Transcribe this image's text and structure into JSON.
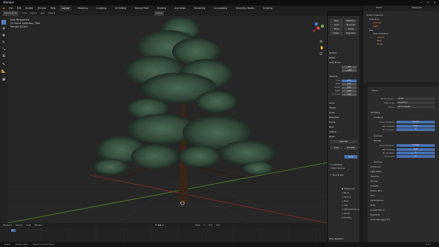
{
  "window": {
    "title": "Blender",
    "controls": [
      "—",
      "☐",
      "✕"
    ]
  },
  "menu": [
    "File",
    "Edit",
    "Render",
    "Window",
    "Help"
  ],
  "workspace_tabs": [
    "Layout",
    "Modeling",
    "Sculpting",
    "UV Editing",
    "Texture Paint",
    "Shading",
    "Animation",
    "Rendering",
    "Compositing",
    "Geometry Nodes",
    "Scripting"
  ],
  "active_tab": "Layout",
  "topright": {
    "scene": "Scene",
    "view_layer": "ViewLayer"
  },
  "viewport_header": {
    "mode": "Object Mode",
    "items": [
      "View",
      "Select",
      "Add",
      "Object"
    ],
    "orientation": "Global"
  },
  "viewport_overlay": {
    "line1": "User Perspective",
    "line2": "(1) Scene Collection | Tree",
    "line3": "Sample 3/1024"
  },
  "npanel": {
    "top_buttons": [
      "Bark",
      "Resolution",
      "Trunk",
      "Branches",
      "Twigs",
      "Leaves",
      "Stems",
      "Twig Apply"
    ],
    "sections": [
      "Record",
      "Reset",
      "Auto Prune",
      "General",
      "Grow",
      "Shape",
      "Trunk",
      "Branches",
      "Prune",
      "Bark",
      "Leaves",
      "Build"
    ],
    "fields": [
      {
        "label": "Seed",
        "value": "101"
      },
      {
        "label": "Branch Fork",
        "value": "1.000"
      },
      {
        "label": "Scale",
        "value": "0.00"
      },
      {
        "label": "Width",
        "value": "0.00"
      },
      {
        "label": "Length",
        "value": "0.00"
      },
      {
        "label": "Height",
        "value": "0.00"
      },
      {
        "label": "Thickness",
        "value": "0.00"
      }
    ],
    "bottom_buttons": [
      "Generate",
      "Build",
      "Simulate",
      "Apply"
    ],
    "checkbox_labels": [
      "Leaf Mesh",
      "Bark Texture",
      "Twig Shape"
    ],
    "presets": [
      "Preference",
      "Birch",
      "Spruce",
      "Pine",
      "Oak",
      "Hardwood Boule",
      "Shrub",
      "Fantasy"
    ],
    "bottom_label": "Tree Variation"
  },
  "outliner": {
    "rows": [
      "Scene Collection",
      "Collection",
      "Camera",
      "Light",
      "Tree",
      "Tree Collection",
      "Leaves",
      "Bark",
      "Twigs"
    ]
  },
  "properties": {
    "object_label": "Scene",
    "render_engine_label": "Render Engine",
    "render_engine": "Cycles",
    "feature_set_label": "Feature Set",
    "feature_set": "Supported",
    "device_label": "Device",
    "device": "GPU Compute",
    "sections": [
      "Sampling",
      "Viewport",
      "Render",
      "Denoise",
      "Advanced",
      "Light Paths",
      "Volumes",
      "Curves",
      "Simplify",
      "Motion Blur",
      "Film",
      "Performance",
      "Bake",
      "Grease Pencil",
      "Freestyle",
      "Color Management"
    ],
    "viewport_fields": [
      {
        "label": "Noise Threshold",
        "value": "0.1000"
      },
      {
        "label": "Max Samples",
        "value": "1024"
      },
      {
        "label": "Min Samples",
        "value": "0"
      }
    ],
    "render_fields": [
      {
        "label": "Noise Threshold",
        "value": "0.0100"
      },
      {
        "label": "Max Samples",
        "value": "4096"
      },
      {
        "label": "Min Samples",
        "value": "0"
      },
      {
        "label": "Time Limit",
        "value": "0 s"
      }
    ]
  },
  "timeline": {
    "items": [
      "Playback",
      "Keying",
      "View",
      "Marker"
    ],
    "start_label": "Start",
    "start": "1",
    "end_label": "End",
    "end": "250",
    "current": "1"
  },
  "statusbar": [
    "Select",
    "Rotate View",
    "Object Context Menu",
    "3.4.1"
  ],
  "colors": {
    "accent": "#4772b3",
    "grid_red": "#8c2b2b",
    "grid_green": "#5b8c2b",
    "foliage": "#3d5d4a",
    "trunk": "#3a2418"
  }
}
